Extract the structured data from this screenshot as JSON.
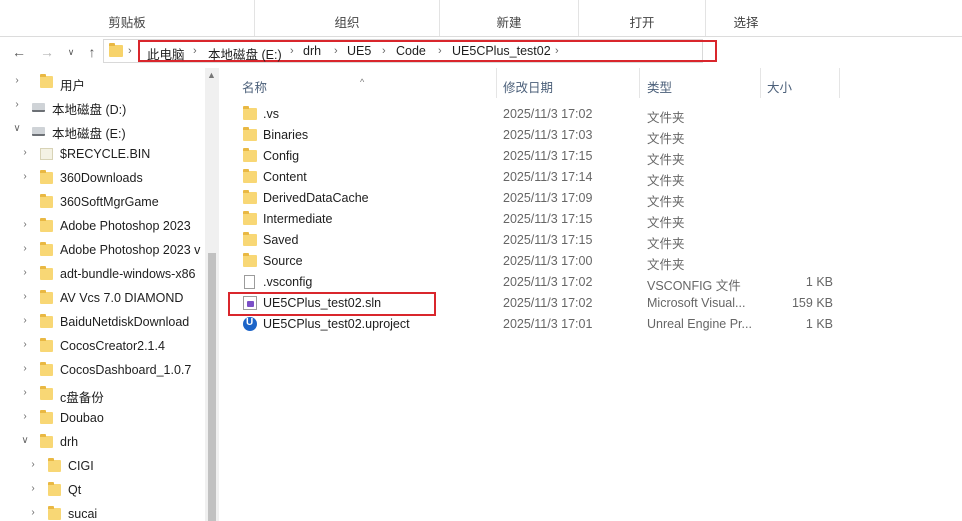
{
  "ribbon": {
    "groups": [
      {
        "label": "剪贴板"
      },
      {
        "label": "组织"
      },
      {
        "label": "新建"
      },
      {
        "label": "打开"
      },
      {
        "label": "选择"
      }
    ]
  },
  "address": {
    "crumbs": [
      "此电脑",
      "本地磁盘 (E:)",
      "drh",
      "UE5",
      "Code",
      "UE5CPlus_test02"
    ]
  },
  "navtree": [
    {
      "label": "用户",
      "icon": "folder-icon",
      "expanded": false
    },
    {
      "label": "本地磁盘 (D:)",
      "icon": "drive-icon",
      "expanded": false
    },
    {
      "label": "本地磁盘 (E:)",
      "icon": "drive-icon",
      "expanded": true
    },
    {
      "label": "$RECYCLE.BIN",
      "icon": "recycle-folder-icon",
      "expanded": false
    },
    {
      "label": "360Downloads",
      "icon": "folder-icon",
      "expanded": false
    },
    {
      "label": "360SoftMgrGame",
      "icon": "folder-icon",
      "expanded": false
    },
    {
      "label": "Adobe Photoshop 2023",
      "icon": "folder-icon",
      "expanded": false
    },
    {
      "label": "Adobe Photoshop 2023 v",
      "icon": "folder-icon",
      "expanded": false
    },
    {
      "label": "adt-bundle-windows-x86",
      "icon": "folder-icon",
      "expanded": false
    },
    {
      "label": "AV Vcs 7.0 DIAMOND",
      "icon": "folder-icon",
      "expanded": false
    },
    {
      "label": "BaiduNetdiskDownload",
      "icon": "folder-icon",
      "expanded": false
    },
    {
      "label": "CocosCreator2.1.4",
      "icon": "folder-icon",
      "expanded": false
    },
    {
      "label": "CocosDashboard_1.0.7",
      "icon": "folder-icon",
      "expanded": false
    },
    {
      "label": "c盘备份",
      "icon": "folder-icon",
      "expanded": false
    },
    {
      "label": "Doubao",
      "icon": "folder-icon",
      "expanded": false
    },
    {
      "label": "drh",
      "icon": "folder-icon",
      "expanded": true
    },
    {
      "label": "CIGI",
      "icon": "folder-icon",
      "expanded": false
    },
    {
      "label": "Qt",
      "icon": "folder-icon",
      "expanded": false
    },
    {
      "label": "sucai",
      "icon": "folder-icon",
      "expanded": false
    }
  ],
  "columns": {
    "name": "名称",
    "date": "修改日期",
    "type": "类型",
    "size": "大小"
  },
  "files": [
    {
      "name": ".vs",
      "date": "2025/11/3 17:02",
      "type": "文件夹",
      "size": "",
      "icon": "folder-icon"
    },
    {
      "name": "Binaries",
      "date": "2025/11/3 17:03",
      "type": "文件夹",
      "size": "",
      "icon": "folder-icon"
    },
    {
      "name": "Config",
      "date": "2025/11/3 17:15",
      "type": "文件夹",
      "size": "",
      "icon": "folder-icon"
    },
    {
      "name": "Content",
      "date": "2025/11/3 17:14",
      "type": "文件夹",
      "size": "",
      "icon": "folder-icon"
    },
    {
      "name": "DerivedDataCache",
      "date": "2025/11/3 17:09",
      "type": "文件夹",
      "size": "",
      "icon": "folder-icon"
    },
    {
      "name": "Intermediate",
      "date": "2025/11/3 17:15",
      "type": "文件夹",
      "size": "",
      "icon": "folder-icon"
    },
    {
      "name": "Saved",
      "date": "2025/11/3 17:15",
      "type": "文件夹",
      "size": "",
      "icon": "folder-icon"
    },
    {
      "name": "Source",
      "date": "2025/11/3 17:00",
      "type": "文件夹",
      "size": "",
      "icon": "folder-icon"
    },
    {
      "name": ".vsconfig",
      "date": "2025/11/3 17:02",
      "type": "VSCONFIG 文件",
      "size": "1 KB",
      "icon": "document-icon"
    },
    {
      "name": "UE5CPlus_test02.sln",
      "date": "2025/11/3 17:02",
      "type": "Microsoft Visual...",
      "size": "159 KB",
      "icon": "visual-studio-solution-icon"
    },
    {
      "name": "UE5CPlus_test02.uproject",
      "date": "2025/11/3 17:01",
      "type": "Unreal Engine Pr...",
      "size": "1 KB",
      "icon": "unreal-engine-icon"
    }
  ],
  "colors": {
    "highlight_box": "#d9262c",
    "folder": "#f8d775"
  }
}
